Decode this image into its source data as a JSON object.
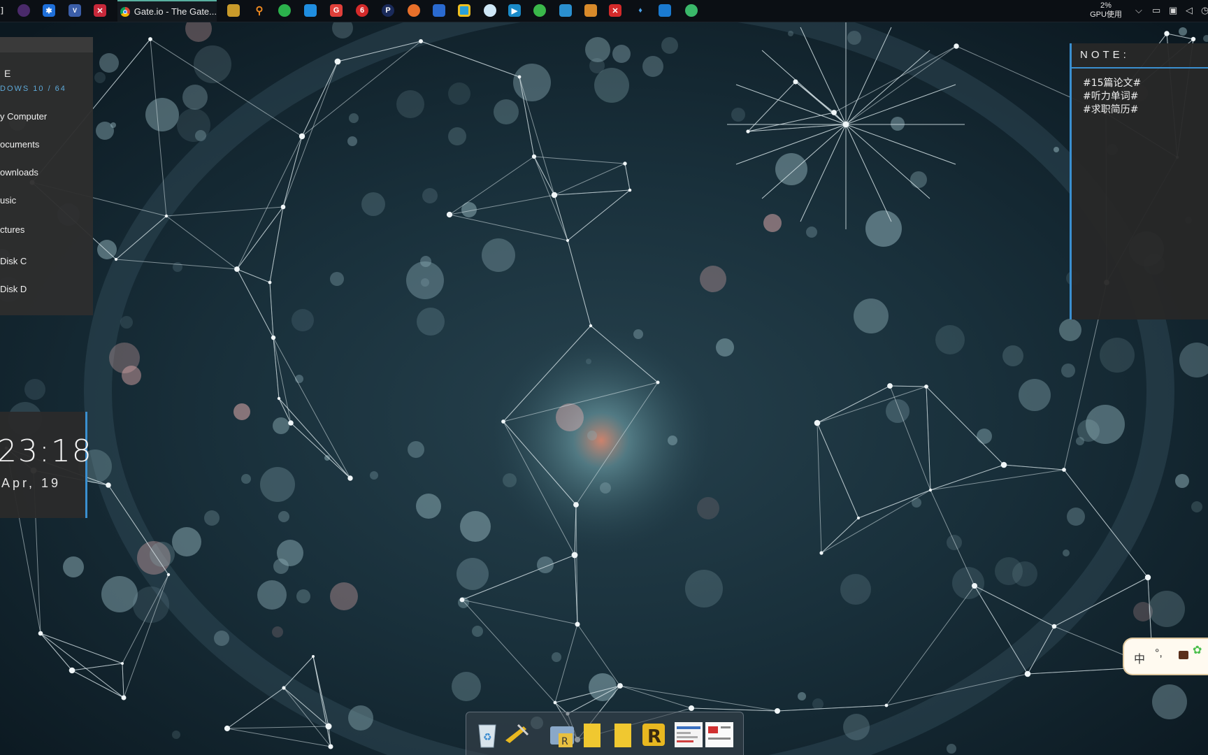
{
  "taskbar": {
    "active_window_title": "Gate.io - The Gate...",
    "gpu_percent": "2%",
    "gpu_label": "GPU使用",
    "pinned_icons": [
      "eclipse-icon",
      "app-star-icon",
      "vs-icon",
      "x-mind-icon",
      "chrome-icon",
      "mail-icon",
      "search-icon",
      "wechat-icon",
      "remote-icon",
      "xiaomi-icon",
      "netease-icon",
      "p-icon",
      "firefox-icon",
      "pdf-icon",
      "square-icon",
      "cloud-icon",
      "video-icon",
      "leaf-icon",
      "network-icon",
      "box-icon",
      "xshell-icon",
      "git-icon",
      "vscode-icon",
      "ball-icon"
    ]
  },
  "launcher": {
    "title": "E",
    "subtitle": "DOWS 10 / 64",
    "items": [
      "y Computer",
      "ocuments",
      "ownloads",
      "usic",
      "ctures",
      "Disk C",
      "Disk D"
    ]
  },
  "clock": {
    "time": "23:18",
    "date": "Apr, 19"
  },
  "note": {
    "heading": "NOTE:",
    "lines": [
      "#15篇论文#",
      "#听力单词#",
      "#求职简历#"
    ]
  },
  "ime": {
    "mode": "中",
    "punctuation": "°,"
  },
  "dock": {
    "items": [
      "recycle-bin-icon",
      "tools-icon",
      "folder-r-icon",
      "folder-yellow-icon",
      "folder-yellow-2-icon",
      "r-app-icon",
      "screenshot-1-icon",
      "screenshot-2-icon"
    ]
  }
}
